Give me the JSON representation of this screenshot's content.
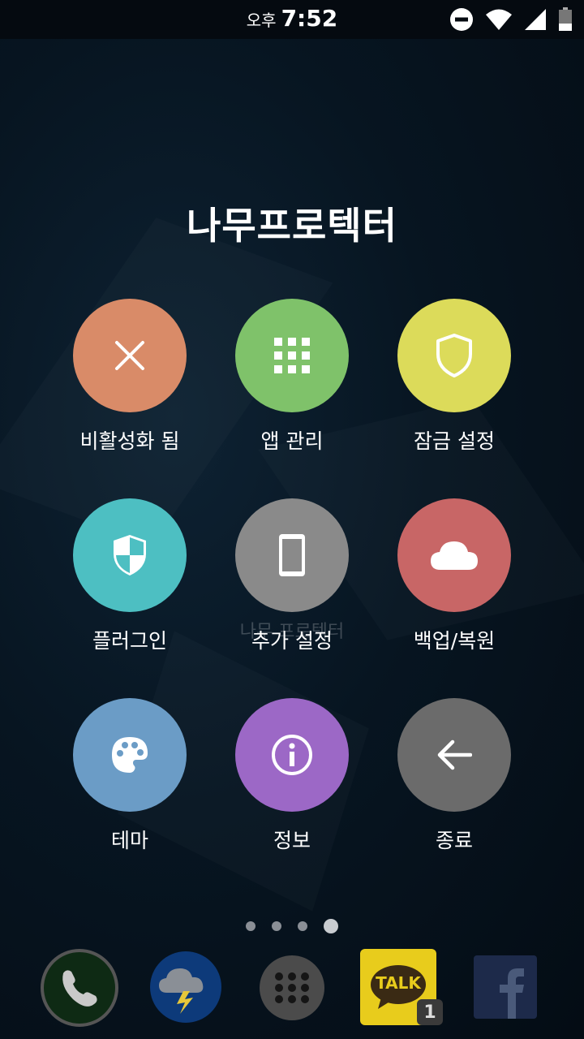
{
  "status_bar": {
    "ampm": "오후",
    "time": "7:52"
  },
  "app": {
    "title": "나무프로텍터",
    "watermark": "나무 프로텍터"
  },
  "menu": [
    {
      "label": "비활성화 됨",
      "icon": "close-icon",
      "color": "#d98b68"
    },
    {
      "label": "앱 관리",
      "icon": "apps-grid-icon",
      "color": "#7fc26a"
    },
    {
      "label": "잠금 설정",
      "icon": "shield-outline-icon",
      "color": "#dcdb5a"
    },
    {
      "label": "플러그인",
      "icon": "shield-check-icon",
      "color": "#4dbfc2"
    },
    {
      "label": "추가 설정",
      "icon": "phone-icon",
      "color": "#8a8a8a"
    },
    {
      "label": "백업/복원",
      "icon": "cloud-icon",
      "color": "#c86666"
    },
    {
      "label": "테마",
      "icon": "palette-icon",
      "color": "#6b9cc6"
    },
    {
      "label": "정보",
      "icon": "info-icon",
      "color": "#9c68c6"
    },
    {
      "label": "종료",
      "icon": "back-arrow-icon",
      "color": "#6b6b6b"
    }
  ],
  "page_indicator": {
    "count": 4,
    "active": 4
  },
  "dock": {
    "kakao_badge": "1",
    "kakao_label": "TALK"
  }
}
